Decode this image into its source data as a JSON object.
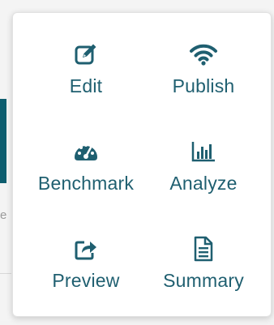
{
  "menu": {
    "items": [
      {
        "id": "edit",
        "label": "Edit",
        "icon": "edit-icon"
      },
      {
        "id": "publish",
        "label": "Publish",
        "icon": "wifi-icon"
      },
      {
        "id": "benchmark",
        "label": "Benchmark",
        "icon": "gauge-icon"
      },
      {
        "id": "analyze",
        "label": "Analyze",
        "icon": "bar-chart-icon"
      },
      {
        "id": "preview",
        "label": "Preview",
        "icon": "share-icon"
      },
      {
        "id": "summary",
        "label": "Summary",
        "icon": "document-icon"
      }
    ],
    "accent_color": "#1f5f70"
  },
  "background": {
    "partial_text": "e"
  }
}
